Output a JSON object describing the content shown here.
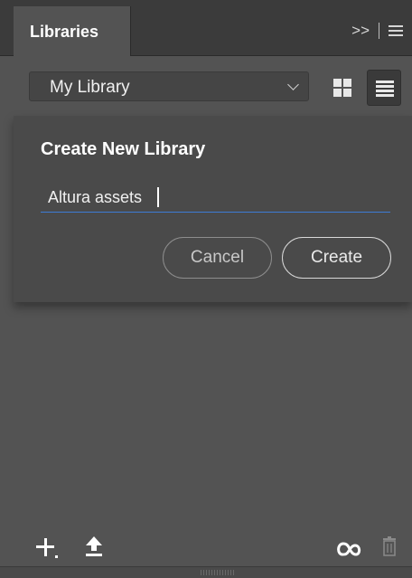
{
  "tabs": {
    "active_label": "Libraries",
    "overflow_label": ">>"
  },
  "library_selector": {
    "selected": "My Library"
  },
  "dialog": {
    "title": "Create New Library",
    "name_input_value": "Altura assets",
    "cancel_label": "Cancel",
    "create_label": "Create"
  },
  "colors": {
    "panel_bg": "#535353",
    "tabstrip_bg": "#3b3b3b",
    "dialog_bg": "#4a4a4a",
    "input_underline": "#3d7bd6"
  },
  "icons": {
    "panel_menu": "hamburger-icon",
    "grid_view": "grid-view-icon",
    "list_view": "list-view-icon",
    "add": "plus-icon",
    "upload": "upload-icon",
    "creative_cloud": "creative-cloud-icon",
    "delete": "trash-icon"
  }
}
